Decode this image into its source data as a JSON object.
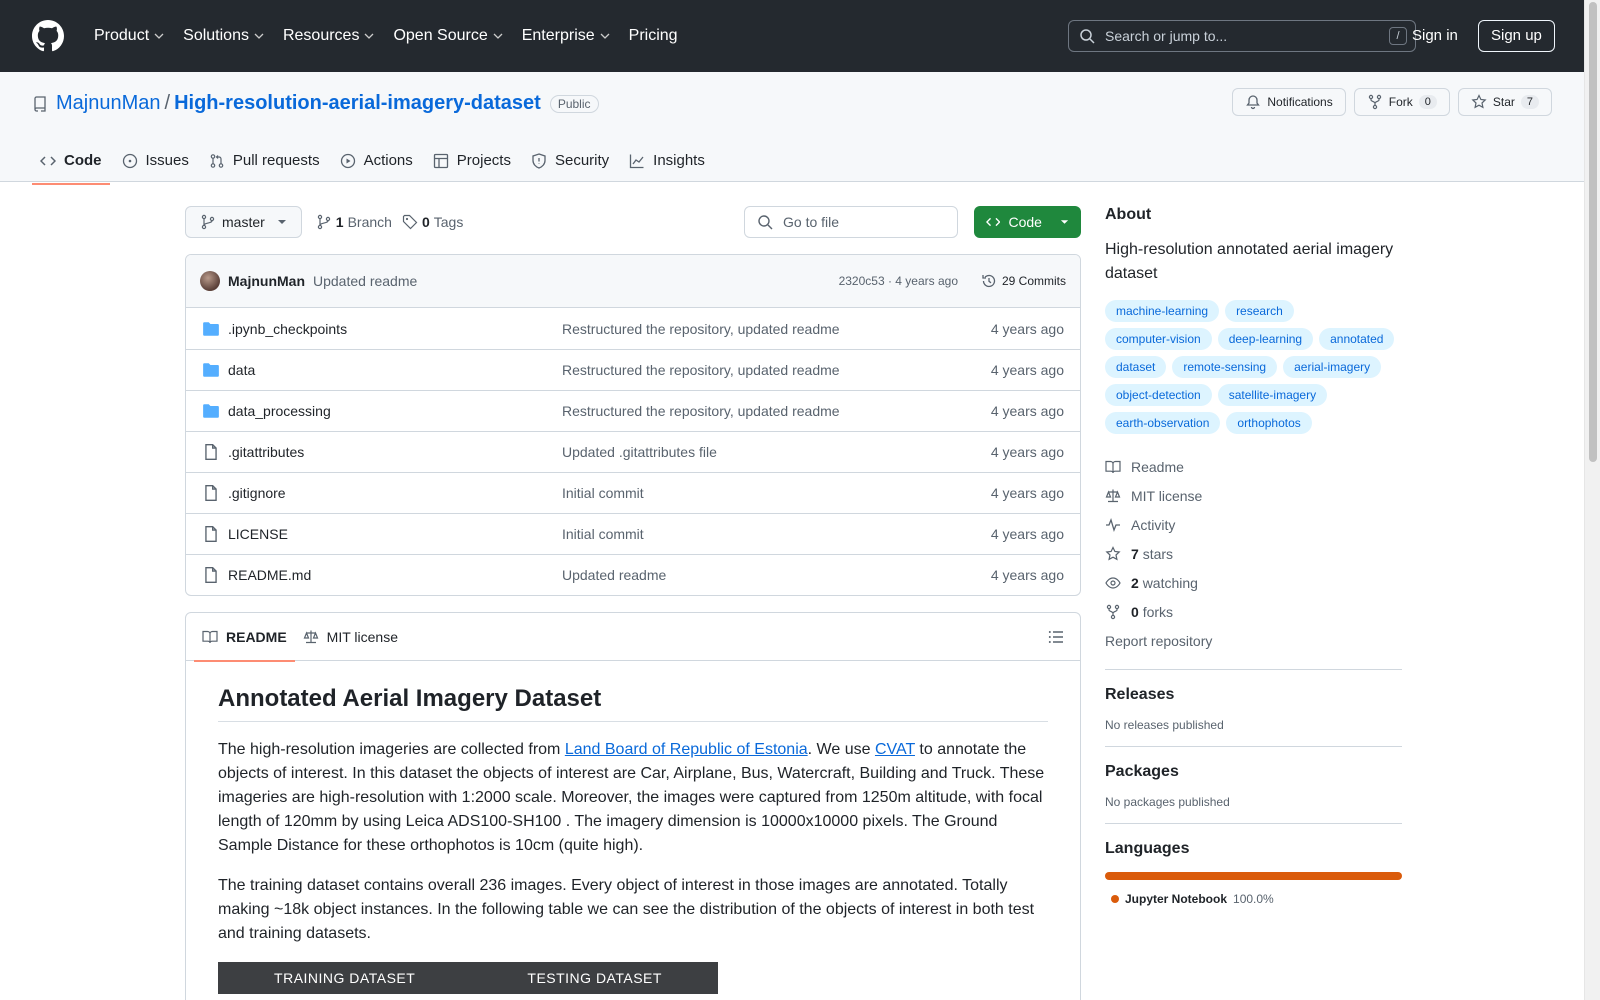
{
  "topnav": {
    "items": [
      {
        "label": "Product",
        "has_menu": true
      },
      {
        "label": "Solutions",
        "has_menu": true
      },
      {
        "label": "Resources",
        "has_menu": true
      },
      {
        "label": "Open Source",
        "has_menu": true
      },
      {
        "label": "Enterprise",
        "has_menu": true
      },
      {
        "label": "Pricing",
        "has_menu": false
      }
    ],
    "search_placeholder": "Search or jump to...",
    "search_shortcut": "/",
    "signin": "Sign in",
    "signup": "Sign up"
  },
  "repo": {
    "owner": "MajnunMan",
    "separator": "/",
    "name": "High-resolution-aerial-imagery-dataset",
    "visibility": "Public",
    "actions": {
      "notifications": "Notifications",
      "fork": "Fork",
      "fork_count": "0",
      "star": "Star",
      "star_count": "7"
    },
    "tabs": [
      {
        "label": "Code",
        "icon": "code-icon"
      },
      {
        "label": "Issues",
        "icon": "issue-icon"
      },
      {
        "label": "Pull requests",
        "icon": "pull-request-icon"
      },
      {
        "label": "Actions",
        "icon": "play-icon"
      },
      {
        "label": "Projects",
        "icon": "table-icon"
      },
      {
        "label": "Security",
        "icon": "shield-icon"
      },
      {
        "label": "Insights",
        "icon": "graph-icon"
      }
    ]
  },
  "branch_bar": {
    "branch": "master",
    "branch_count": "1",
    "branch_label": "Branch",
    "tag_count": "0",
    "tag_label": "Tags",
    "goto_placeholder": "Go to file",
    "code_button": "Code"
  },
  "latest_commit": {
    "author": "MajnunMan",
    "message": "Updated readme",
    "meta": "2320c53 · 4 years ago",
    "commits": "29 Commits"
  },
  "files": [
    {
      "name": ".ipynb_checkpoints",
      "type": "folder",
      "commit": "Restructured the repository, updated readme",
      "age": "4 years ago"
    },
    {
      "name": "data",
      "type": "folder",
      "commit": "Restructured the repository, updated readme",
      "age": "4 years ago"
    },
    {
      "name": "data_processing",
      "type": "folder",
      "commit": "Restructured the repository, updated readme",
      "age": "4 years ago"
    },
    {
      "name": ".gitattributes",
      "type": "file",
      "commit": "Updated .gitattributes file",
      "age": "4 years ago"
    },
    {
      "name": ".gitignore",
      "type": "file",
      "commit": "Initial commit",
      "age": "4 years ago"
    },
    {
      "name": "LICENSE",
      "type": "file",
      "commit": "Initial commit",
      "age": "4 years ago"
    },
    {
      "name": "README.md",
      "type": "file",
      "commit": "Updated readme",
      "age": "4 years ago"
    }
  ],
  "readme": {
    "tab_readme": "README",
    "tab_license": "MIT license",
    "title": "Annotated Aerial Imagery Dataset",
    "p1_a": "The high-resolution imageries are collected from ",
    "p1_link1": "Land Board of Republic of Estonia",
    "p1_b": ". We use ",
    "p1_link2": "CVAT",
    "p1_c": " to annotate the objects of interest. In this dataset the objects of interest are Car, Airplane, Bus, Watercraft, Building and Truck. These imageries are high-resolution with 1:2000 scale. Moreover, the images were captured from 1250m altitude, with focal length of 120mm by using Leica ADS100-SH100 . The imagery dimension is 10000x10000 pixels. The Ground Sample Distance for these orthophotos is 10cm (quite high).",
    "p2": "The training dataset contains overall 236 images. Every object of interest in those images are annotated. Totally making ~18k object instances. In the following table we can see the distribution of the objects of interest in both test and training datasets.",
    "table_col1": "TRAINING DATASET",
    "table_col2": "TESTING DATASET"
  },
  "about": {
    "heading": "About",
    "description": "High-resolution annotated aerial imagery dataset",
    "topics": [
      "machine-learning",
      "research",
      "computer-vision",
      "deep-learning",
      "annotated",
      "dataset",
      "remote-sensing",
      "aerial-imagery",
      "object-detection",
      "satellite-imagery",
      "earth-observation",
      "orthophotos"
    ],
    "readme": "Readme",
    "license": "MIT license",
    "activity": "Activity",
    "stars_count": "7",
    "stars_label": "stars",
    "watching_count": "2",
    "watching_label": "watching",
    "forks_count": "0",
    "forks_label": "forks",
    "report": "Report repository"
  },
  "releases": {
    "heading": "Releases",
    "text": "No releases published"
  },
  "packages": {
    "heading": "Packages",
    "text": "No packages published"
  },
  "languages": {
    "heading": "Languages",
    "name": "Jupyter Notebook",
    "percent": "100.0%",
    "color": "#DA5B0B"
  }
}
